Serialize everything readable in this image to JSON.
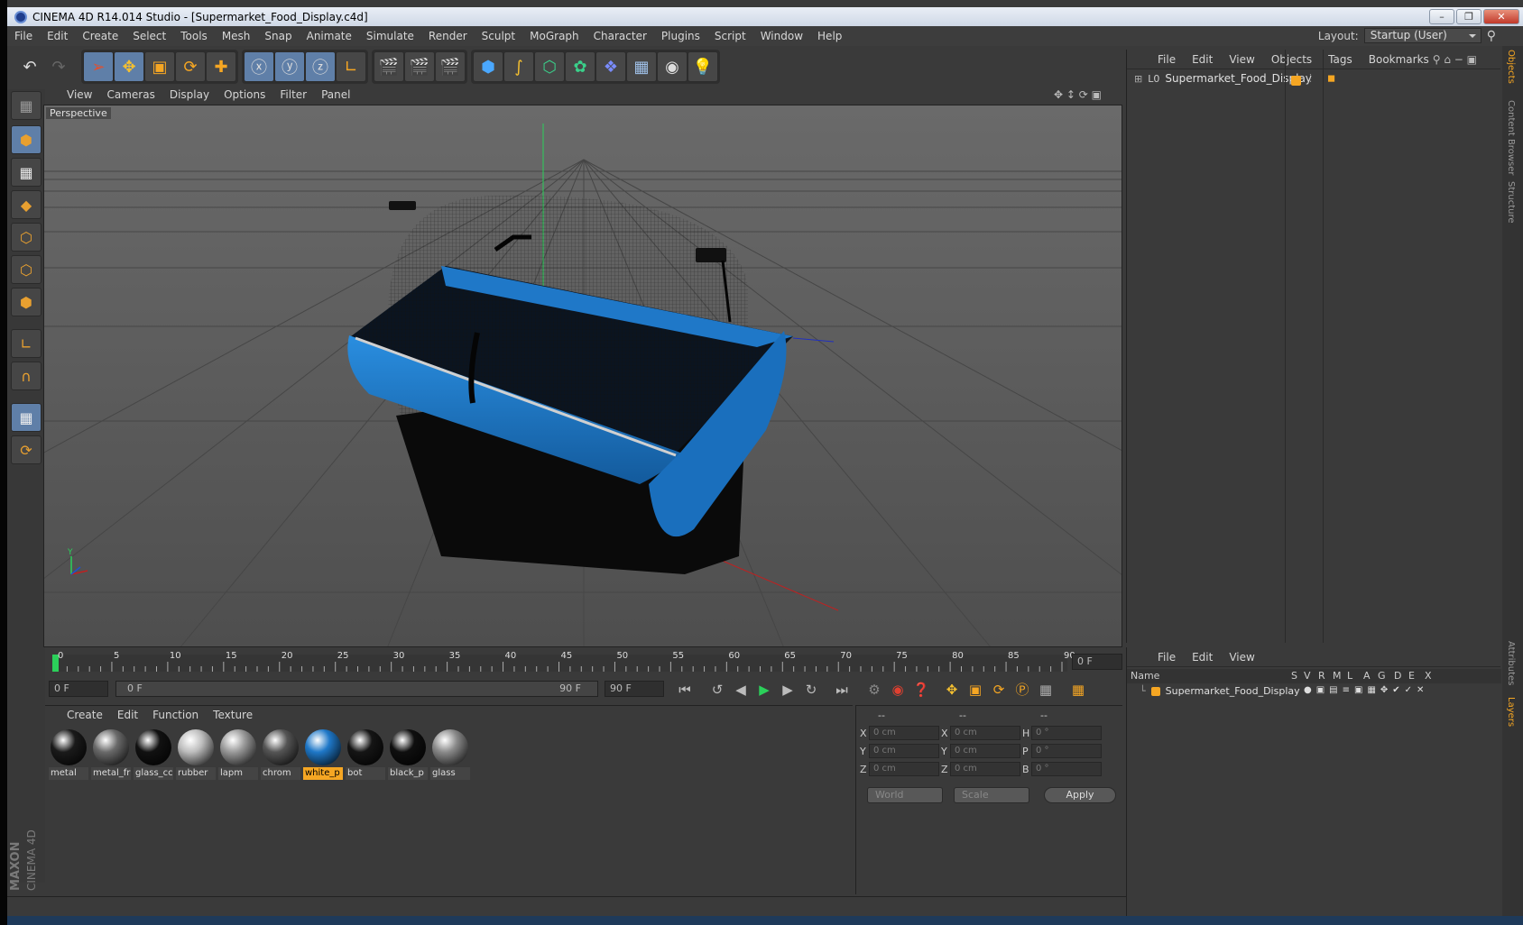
{
  "window": {
    "title": "CINEMA 4D R14.014 Studio - [Supermarket_Food_Display.c4d]"
  },
  "menu": [
    "File",
    "Edit",
    "Create",
    "Select",
    "Tools",
    "Mesh",
    "Snap",
    "Animate",
    "Simulate",
    "Render",
    "Sculpt",
    "MoGraph",
    "Character",
    "Plugins",
    "Script",
    "Window",
    "Help"
  ],
  "layout": {
    "label": "Layout:",
    "value": "Startup (User)"
  },
  "viewport": {
    "menu": [
      "View",
      "Cameras",
      "Display",
      "Options",
      "Filter",
      "Panel"
    ],
    "label": "Perspective"
  },
  "timeline": {
    "ticks": [
      "0",
      "5",
      "10",
      "15",
      "20",
      "25",
      "30",
      "35",
      "40",
      "45",
      "50",
      "55",
      "60",
      "65",
      "70",
      "75",
      "80",
      "85",
      "90"
    ],
    "current_frame": "0 F",
    "start_field": "0 F",
    "range_start": "0 F",
    "range_end": "90 F",
    "end_field": "90 F"
  },
  "materials": {
    "menu": [
      "Create",
      "Edit",
      "Function",
      "Texture"
    ],
    "items": [
      {
        "name": "metal",
        "color": "#1a1a1a"
      },
      {
        "name": "metal_fr",
        "color": "#6a6a6a"
      },
      {
        "name": "glass_cc",
        "color": "#111111"
      },
      {
        "name": "rubber",
        "color": "#bdbdbd"
      },
      {
        "name": "lapm",
        "color": "#9a9a9a"
      },
      {
        "name": "chrom",
        "color": "#555555"
      },
      {
        "name": "white_p",
        "color": "#1f78c8"
      },
      {
        "name": "bot",
        "color": "#151515"
      },
      {
        "name": "black_p",
        "color": "#0f0f0f"
      },
      {
        "name": "glass",
        "color": "#8a8a8a"
      }
    ],
    "selected": "white_p"
  },
  "coordinates": {
    "headers": [
      "--",
      "--",
      "--"
    ],
    "rows": [
      {
        "a": "X",
        "av": "0 cm",
        "b": "X",
        "bv": "0 cm",
        "c": "H",
        "cv": "0 °"
      },
      {
        "a": "Y",
        "av": "0 cm",
        "b": "Y",
        "bv": "0 cm",
        "c": "P",
        "cv": "0 °"
      },
      {
        "a": "Z",
        "av": "0 cm",
        "b": "Z",
        "bv": "0 cm",
        "c": "B",
        "cv": "0 °"
      }
    ],
    "world": "World",
    "scale": "Scale",
    "apply": "Apply"
  },
  "objects": {
    "menu": [
      "File",
      "Edit",
      "View",
      "Objects",
      "Tags",
      "Bookmarks"
    ],
    "item": "Supermarket_Food_Display"
  },
  "layers": {
    "menu": [
      "File",
      "Edit",
      "View"
    ],
    "columns": [
      "Name",
      "S",
      "V",
      "R",
      "M",
      "L",
      "A",
      "G",
      "D",
      "E",
      "X"
    ],
    "item": "Supermarket_Food_Display"
  },
  "sidetabs": [
    "Objects",
    "Content Browser",
    "Structure",
    "Attributes",
    "Layers"
  ],
  "brand": {
    "maxon": "MAXON",
    "c4d": "CINEMA 4D"
  },
  "colors": {
    "accent": "#f5a623",
    "display_blue": "#1f78c8",
    "selection": "#5f7fa8"
  }
}
